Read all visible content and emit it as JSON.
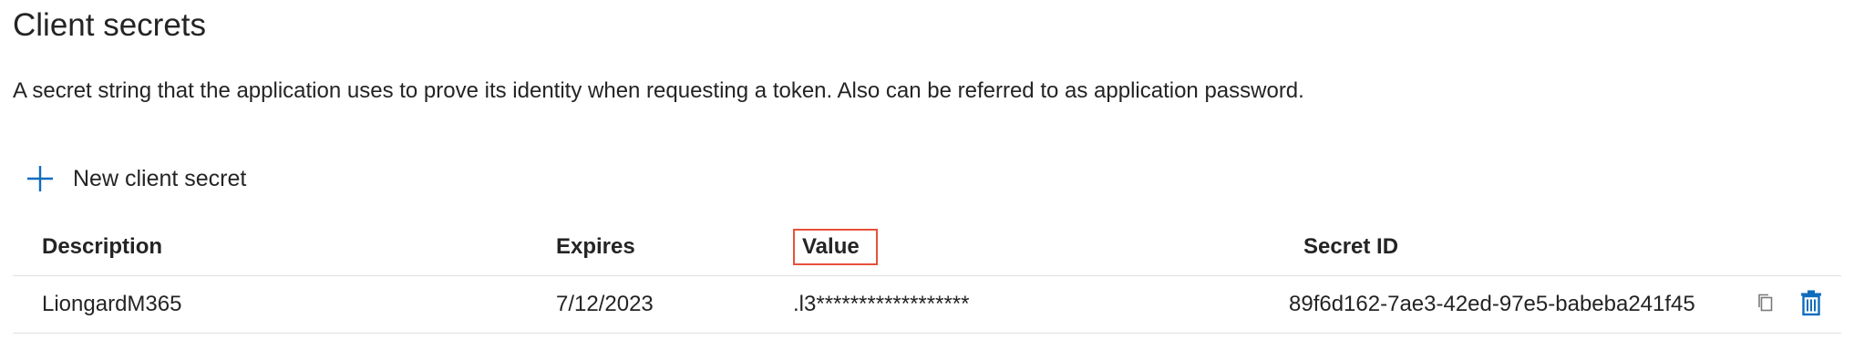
{
  "section": {
    "title": "Client secrets",
    "description": "A secret string that the application uses to prove its identity when requesting a token. Also can be referred to as application password."
  },
  "toolbar": {
    "new_secret_label": "New client secret",
    "new_secret_icon": "plus-icon"
  },
  "table": {
    "headers": {
      "description": "Description",
      "expires": "Expires",
      "value": "Value",
      "secret_id": "Secret ID"
    },
    "rows": [
      {
        "description": "LiongardM365",
        "expires": "7/12/2023",
        "value": ".l3******************",
        "secret_id": "89f6d162-7ae3-42ed-97e5-babeba241f45",
        "actions": [
          "copy-icon",
          "delete-icon"
        ]
      }
    ]
  },
  "colors": {
    "accent": "#0f6cbd",
    "highlight_border": "#e8503a",
    "divider": "#e1e1e1",
    "text": "#242424"
  }
}
